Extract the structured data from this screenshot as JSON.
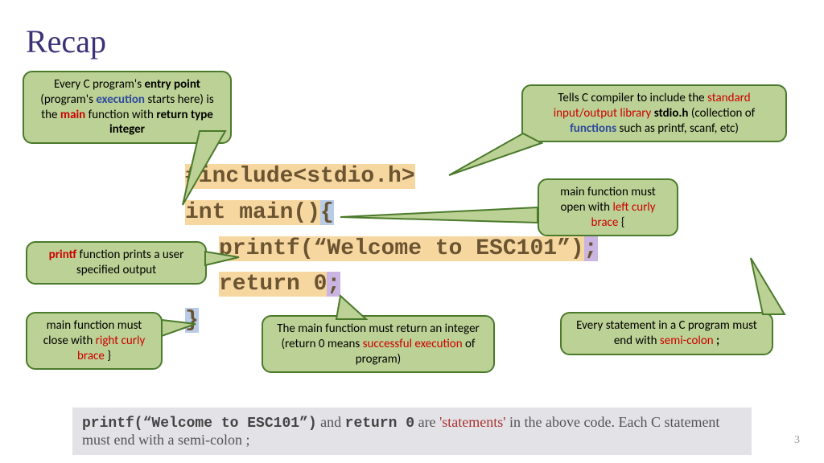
{
  "title": "Recap",
  "callouts": {
    "entry": {
      "pre": "Every C program's ",
      "b1": "entry point",
      "mid1": " (program's ",
      "blue1": "execution",
      "mid2": " starts here) is the ",
      "red1": "main",
      "mid3": " function with ",
      "b2": "return type integer"
    },
    "stdio": {
      "pre": "Tells C compiler to include the ",
      "red1": "standard input/output library",
      "mid1": " ",
      "b1": "stdio.h",
      "mid2": " (collection of ",
      "blue1": "functions",
      "mid3": " such as printf, scanf, etc)"
    },
    "open": {
      "pre": "main function must open with ",
      "red1": "left curly brace",
      "post": " {"
    },
    "printf": {
      "red1": "printf",
      "post": " function prints a user specified output"
    },
    "close": {
      "pre": "main function must close with ",
      "red1": "right curly brace",
      "post": " }"
    },
    "return": {
      "pre": "The main function must return an integer (return 0 means ",
      "red1": "successful execution",
      "post": " of program)"
    },
    "semi": {
      "pre": "Every statement in a C program must end with ",
      "red1": "semi-colon",
      "post": " ",
      "b1": ";"
    }
  },
  "code": {
    "l1": "#include<stdio.h>",
    "l2a": "int main()",
    "l2b": "{",
    "l3a": "printf(“Welcome to ESC101”)",
    "l3b": ";",
    "l4a": "return 0",
    "l4b": ";",
    "l5": "}"
  },
  "footer": {
    "m1": "printf(“Welcome to ESC101”)",
    "t1": " and ",
    "m2": "return 0",
    "t2": " are ",
    "stmt": "'statements'",
    "t3": " in the above code. Each C statement must end with a semi-colon ;"
  },
  "pagenum": "3"
}
